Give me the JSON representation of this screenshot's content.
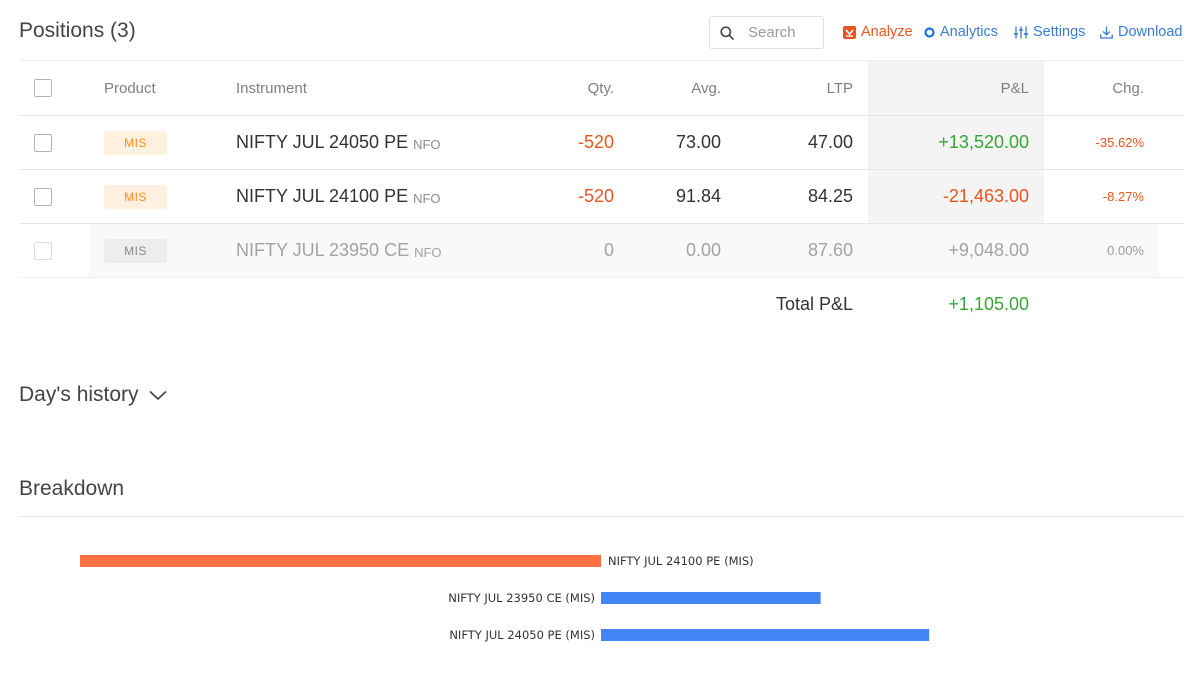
{
  "header": {
    "title": "Positions (3)",
    "search_placeholder": "Search",
    "analyze_label": "Analyze",
    "analytics_label": "Analytics",
    "settings_label": "Settings",
    "download_label": "Download"
  },
  "table": {
    "columns": {
      "product": "Product",
      "instrument": "Instrument",
      "qty": "Qty.",
      "avg": "Avg.",
      "ltp": "LTP",
      "pl": "P&L",
      "chg": "Chg."
    },
    "rows": [
      {
        "product": "MIS",
        "instrument": "NIFTY JUL 24050 PE",
        "exchange": "NFO",
        "qty": "-520",
        "avg": "73.00",
        "ltp": "47.00",
        "pl": "+13,520.00",
        "chg": "-35.62%"
      },
      {
        "product": "MIS",
        "instrument": "NIFTY JUL 24100 PE",
        "exchange": "NFO",
        "qty": "-520",
        "avg": "91.84",
        "ltp": "84.25",
        "pl": "-21,463.00",
        "chg": "-8.27%"
      },
      {
        "product": "MIS",
        "instrument": "NIFTY JUL 23950 CE",
        "exchange": "NFO",
        "qty": "0",
        "avg": "0.00",
        "ltp": "87.60",
        "pl": "+9,048.00",
        "chg": "0.00%"
      }
    ],
    "total_label": "Total P&L",
    "total_value": "+1,105.00"
  },
  "days_history": {
    "label": "Day's history"
  },
  "breakdown": {
    "title": "Breakdown"
  },
  "colors": {
    "loss": "#ff7043",
    "profit": "#4285f4",
    "loss_text": "#e9551f",
    "profit_text": "#38a638",
    "link": "#387ed1"
  },
  "icons": {
    "search": "search-icon",
    "analyze": "analyze-icon",
    "analytics": "analytics-icon",
    "settings": "settings-sliders-icon",
    "download": "download-icon",
    "expand": "chevron-down-icon"
  },
  "chart_data": {
    "type": "bar",
    "orientation": "horizontal",
    "categories": [
      "NIFTY JUL 24100 PE (MIS)",
      "NIFTY JUL 23950 CE (MIS)",
      "NIFTY JUL 24050 PE (MIS)"
    ],
    "values": [
      -21463,
      9048,
      13520
    ],
    "title": "",
    "xlabel": "",
    "ylabel": ""
  }
}
